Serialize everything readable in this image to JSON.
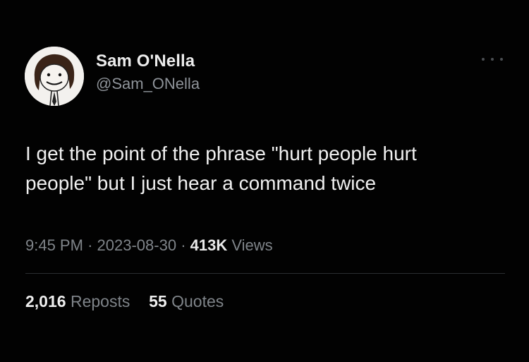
{
  "author": {
    "display_name": "Sam O'Nella",
    "handle": "@Sam_ONella"
  },
  "icons": {
    "more": "more-horizontal-icon",
    "avatar": "cartoon-face-avatar"
  },
  "tweet": {
    "text": "I get the point of the phrase \"hurt people hurt\npeople\" but I just hear a command twice",
    "time": "9:45 PM",
    "date": "2023-08-30",
    "separator": "·",
    "views_count": "413K",
    "views_label": "Views"
  },
  "stats": {
    "reposts_count": "2,016",
    "reposts_label": "Reposts",
    "quotes_count": "55",
    "quotes_label": "Quotes"
  },
  "colors": {
    "background": "#020202",
    "primary_text": "#e7e9ea",
    "secondary_text": "#7f8489",
    "divider": "#2b2e31"
  }
}
